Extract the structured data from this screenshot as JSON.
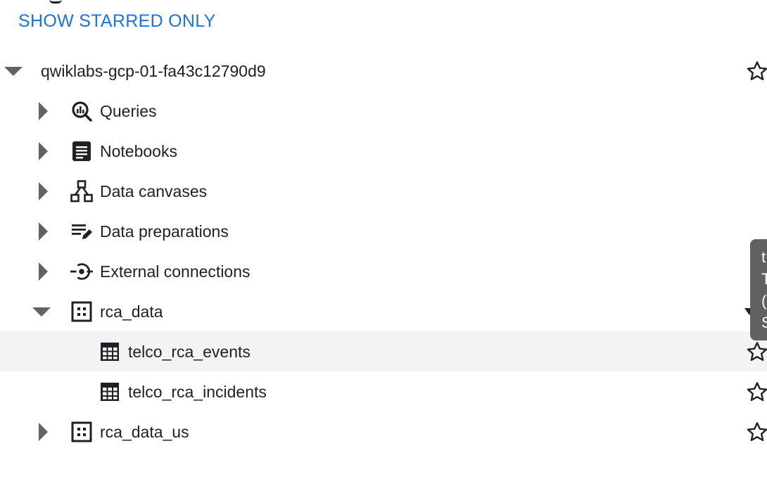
{
  "toolbar": {
    "show_starred_label": "SHOW STARRED ONLY"
  },
  "tree": {
    "project": {
      "label": "qwiklabs-gcp-01-fa43c12790d9",
      "expanded": true,
      "starred": false
    },
    "items": [
      {
        "label": "Queries",
        "icon": "queries-icon",
        "expanded": false
      },
      {
        "label": "Notebooks",
        "icon": "notebook-icon",
        "expanded": false
      },
      {
        "label": "Data canvases",
        "icon": "data-canvas-icon",
        "expanded": false
      },
      {
        "label": "Data preparations",
        "icon": "data-preparation-icon",
        "expanded": false
      },
      {
        "label": "External connections",
        "icon": "connection-icon",
        "expanded": false
      },
      {
        "label": "rca_data",
        "icon": "dataset-icon",
        "expanded": true,
        "children": [
          {
            "label": "telco_rca_events",
            "icon": "table-icon",
            "selected": true
          },
          {
            "label": "telco_rca_incidents",
            "icon": "table-icon",
            "selected": false
          }
        ]
      },
      {
        "label": "rca_data_us",
        "icon": "dataset-icon",
        "expanded": false
      }
    ]
  },
  "tooltip": {
    "lines": [
      "t",
      "T",
      "(",
      "S"
    ]
  },
  "colors": {
    "accent": "#1a73e8",
    "selected_row": "#f1f3f4",
    "tooltip_bg": "#616161",
    "icon": "#202124"
  }
}
